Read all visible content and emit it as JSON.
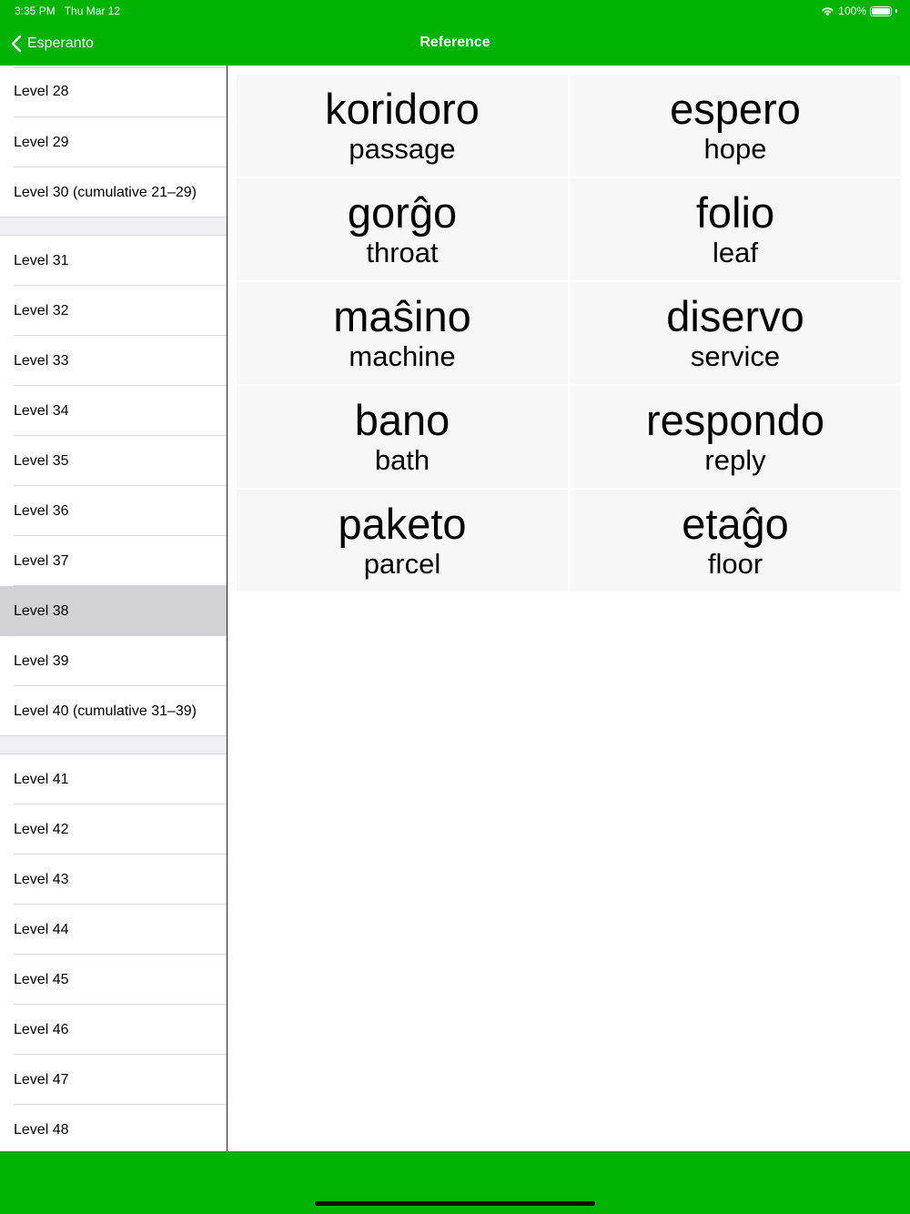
{
  "status_bar": {
    "time": "3:35 PM",
    "date": "Thu Mar 12",
    "battery": "100%"
  },
  "nav": {
    "back_label": "Esperanto",
    "title": "Reference"
  },
  "sidebar": {
    "sections": [
      [
        "Level 28",
        "Level 29",
        "Level 30 (cumulative 21–29)"
      ],
      [
        "Level 31",
        "Level 32",
        "Level 33",
        "Level 34",
        "Level 35",
        "Level 36",
        "Level 37",
        "Level 38",
        "Level 39",
        "Level 40 (cumulative 31–39)"
      ],
      [
        "Level 41",
        "Level 42",
        "Level 43",
        "Level 44",
        "Level 45",
        "Level 46",
        "Level 47",
        "Level 48"
      ]
    ],
    "selected": "Level 38"
  },
  "cards": [
    {
      "term": "koridoro",
      "gloss": "passage"
    },
    {
      "term": "espero",
      "gloss": "hope"
    },
    {
      "term": "gorĝo",
      "gloss": "throat"
    },
    {
      "term": "folio",
      "gloss": "leaf"
    },
    {
      "term": "maŝino",
      "gloss": "machine"
    },
    {
      "term": "diservo",
      "gloss": "service"
    },
    {
      "term": "bano",
      "gloss": "bath"
    },
    {
      "term": "respondo",
      "gloss": "reply"
    },
    {
      "term": "paketo",
      "gloss": "parcel"
    },
    {
      "term": "etaĝo",
      "gloss": "floor"
    }
  ],
  "colors": {
    "accent": "#00B300",
    "selected_row": "#d1d1d6",
    "card_bg": "#f7f7f7"
  }
}
